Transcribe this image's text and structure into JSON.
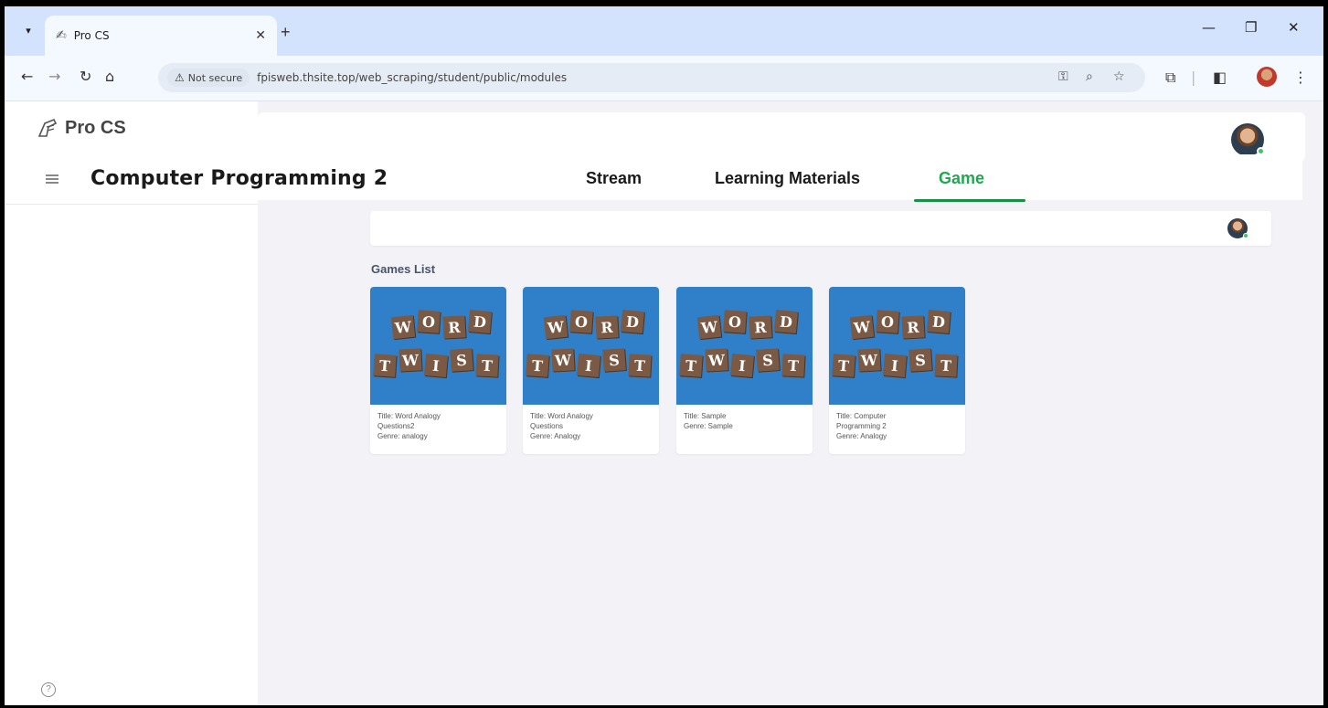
{
  "browser": {
    "tab_title": "Pro CS",
    "security_label": "Not secure",
    "url": "fpisweb.thsite.top/web_scraping/student/public/modules"
  },
  "sidebar": {
    "brand": "Pro CS"
  },
  "course": {
    "title": "Computer Programming 2",
    "nav": [
      {
        "label": "Stream",
        "active": false
      },
      {
        "label": "Learning Materials",
        "active": false
      },
      {
        "label": "Game",
        "active": true
      }
    ]
  },
  "games_section": {
    "heading": "Games List",
    "thumbnail_words": [
      "WORD",
      "TWIST"
    ],
    "games": [
      {
        "title_line1": "Title: Word Analogy",
        "title_line2": "Questions2",
        "genre": "Genre: analogy"
      },
      {
        "title_line1": "Title: Word Analogy",
        "title_line2": "Questions",
        "genre": "Genre: Analogy"
      },
      {
        "title_line1": "Title: Sample",
        "title_line2": "",
        "genre": "Genre: Sample"
      },
      {
        "title_line1": "Title: Computer",
        "title_line2": "Programming 2",
        "genre": "Genre: Analogy"
      }
    ]
  },
  "colors": {
    "active_nav": "#1fa84f",
    "thumbnail_bg": "#2f80c9",
    "tile": "#7a5a44"
  }
}
